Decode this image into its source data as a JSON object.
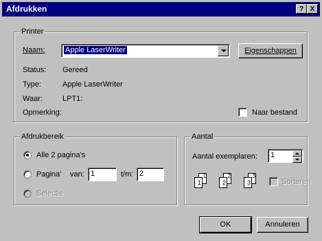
{
  "window": {
    "title": "Afdrukken",
    "help": "?",
    "close": "X"
  },
  "printer": {
    "group_label": "Printer",
    "name_label": "Naam:",
    "name_value": "Apple LaserWriter",
    "properties_button": "Eigenschappen",
    "status_label": "Status:",
    "status_value": "Gereed",
    "type_label": "Type:",
    "type_value": "Apple LaserWriter",
    "where_label": "Waar:",
    "where_value": "LPT1:",
    "comment_label": "Opmerking:",
    "print_to_file": "Naar bestand"
  },
  "range": {
    "group_label": "Afdrukbereik",
    "all": "Alle 2 pagina's",
    "pages": "Pagina'",
    "from_label": "van:",
    "from_value": "1",
    "to_label": "t/m:",
    "to_value": "2",
    "selection": "Selectie"
  },
  "copies": {
    "group_label": "Aantal",
    "count_label": "Aantal exemplaren:",
    "count_value": "1",
    "collate": "Sorteren"
  },
  "buttons": {
    "ok": "OK",
    "cancel": "Annuleren"
  }
}
